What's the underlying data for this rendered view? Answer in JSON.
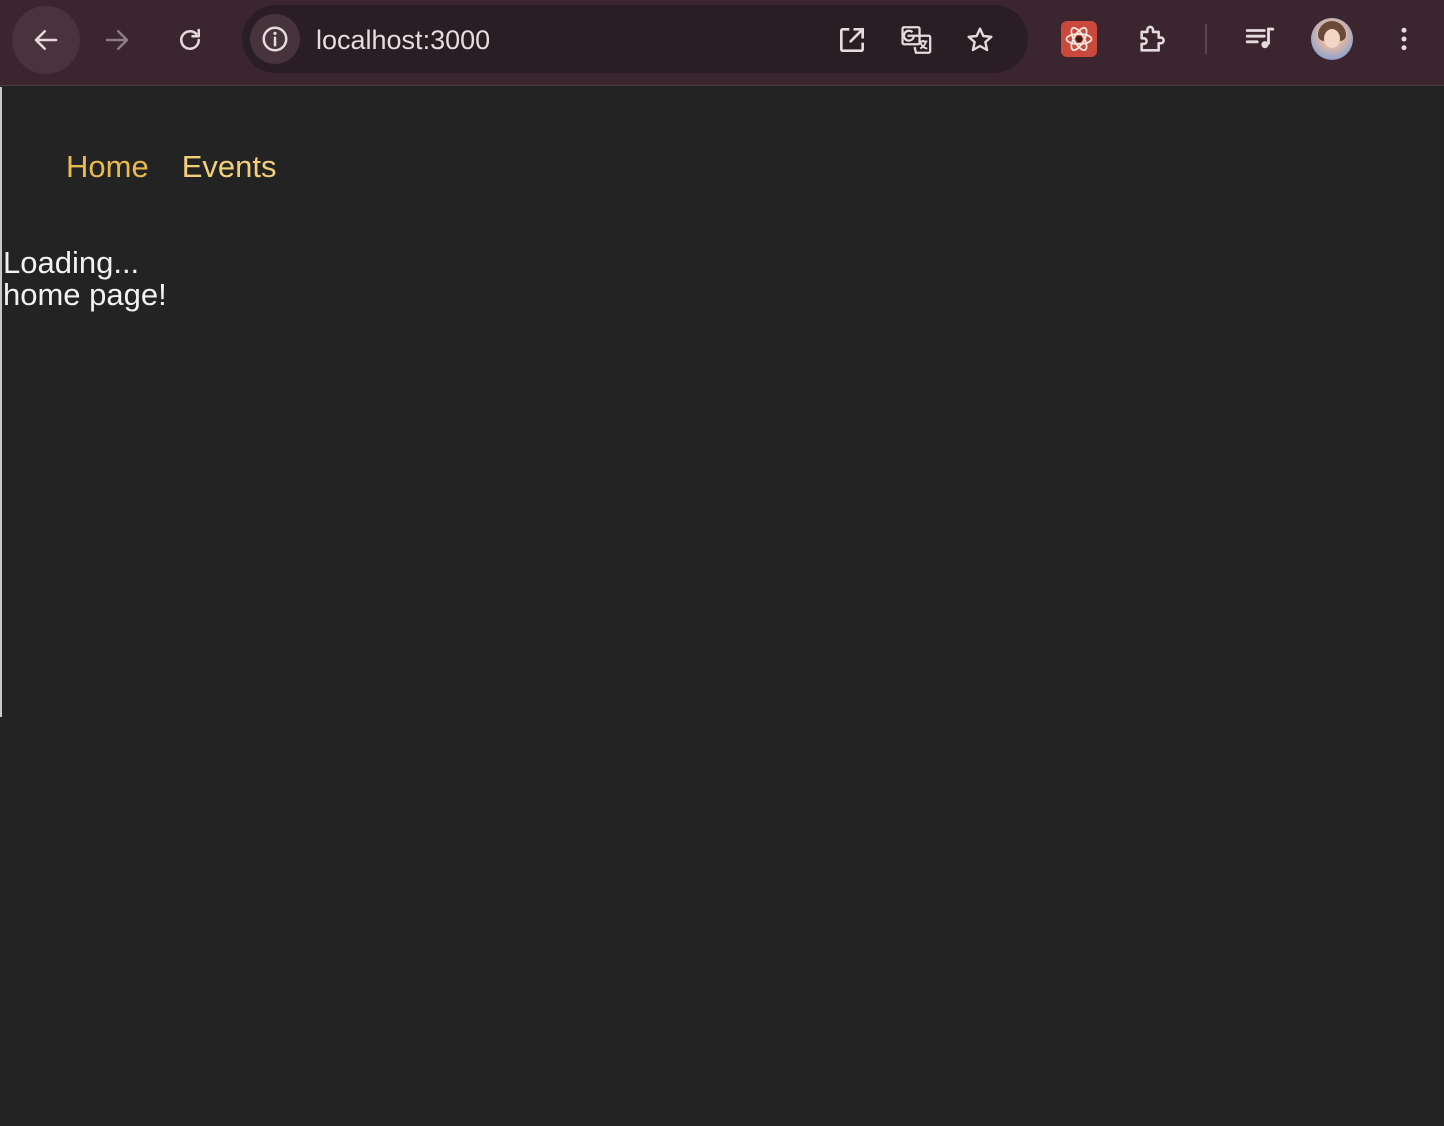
{
  "browser": {
    "url": "localhost:3000",
    "icons": {
      "back": "arrow-left-icon",
      "forward": "arrow-right-icon",
      "reload": "reload-icon",
      "site_info": "info-icon",
      "open_in_app": "open-external-icon",
      "translate": "translate-icon",
      "bookmark": "star-icon",
      "react_devtools": "react-atom-icon",
      "extensions": "puzzle-icon",
      "media": "media-queue-icon",
      "profile": "avatar",
      "menu": "kebab-menu-icon"
    },
    "colors": {
      "toolbar": "#3b252f",
      "omnibox": "#2a1d23",
      "react_badge": "#c94a3c"
    }
  },
  "nav": {
    "links": [
      {
        "label": "Home",
        "color": "#e9b94f"
      },
      {
        "label": "Events",
        "color": "#f2cf7a"
      }
    ]
  },
  "content": {
    "loading": "Loading...",
    "message": "home page!"
  },
  "colors": {
    "page_background": "#232323",
    "text": "#f2f2f2"
  }
}
